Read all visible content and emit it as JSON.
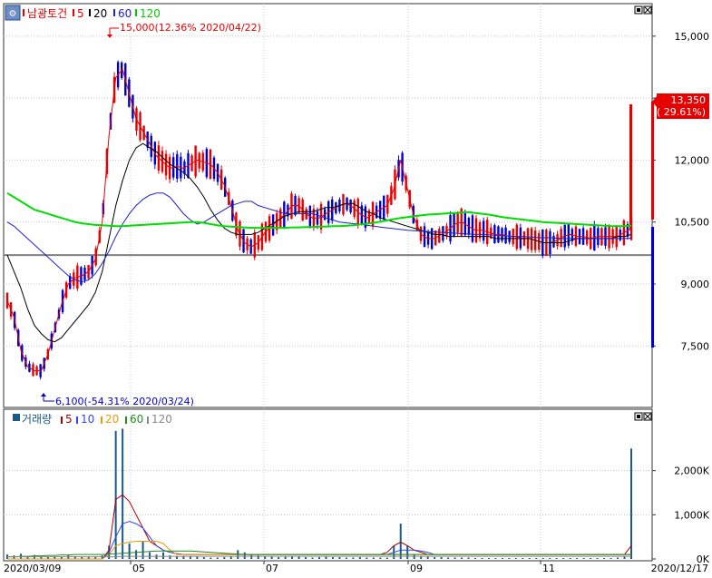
{
  "legend": {
    "price": {
      "name": "남광토건",
      "ma5": "5",
      "ma20": "20",
      "ma60": "60",
      "ma120": "120"
    },
    "volume": {
      "name": "거래량",
      "ma5": "5",
      "ma10": "10",
      "ma20": "20",
      "ma60": "60",
      "ma120": "120"
    }
  },
  "colors": {
    "up": "#e60000",
    "down": "#0000cc",
    "ma5": "#e60000",
    "ma20": "#000000",
    "ma60": "#2222cc",
    "ma120": "#00dd00",
    "vol_ma5": "#aa0000",
    "vol_ma10": "#3344ee",
    "vol_ma20": "#ee9900",
    "vol_ma60": "#228822",
    "vol_ma120": "#888888",
    "volume_bar": "#1a5a8a",
    "refline": "#808080"
  },
  "annotations": {
    "high": "15,000(12.36% 2020/04/22)",
    "low": "6,100(-54.31% 2020/03/24)"
  },
  "price_tag": {
    "value": "13,350",
    "change": "( 29.61%)"
  },
  "chart_data": [
    {
      "type": "candlestick",
      "ylim": [
        6100,
        15700
      ],
      "yticks": [
        "15,000",
        "13,500",
        "12,000",
        "10,500",
        "9,000",
        "7,500"
      ],
      "ytick_values": [
        15000,
        13500,
        12000,
        10500,
        9000,
        7500
      ],
      "reference_line": 9700,
      "xtick_labels": [
        "05",
        "07",
        "09",
        "11"
      ],
      "x_start_label": "2020/03/09",
      "x_end_label": "2020/12/17",
      "series": [
        {
          "name": "5",
          "values": [
            8600,
            8200,
            7400,
            7000,
            6900,
            6900,
            7300,
            7900,
            8500,
            9000,
            9150,
            9200,
            9300,
            9600,
            10500,
            12600,
            14000,
            14200,
            13600,
            13000,
            12700,
            12400,
            12100,
            11950,
            11800,
            11850,
            11800,
            11900,
            12000,
            11950,
            11900,
            11700,
            11400,
            10900,
            10300,
            10000,
            9900,
            10000,
            10250,
            10400,
            10550,
            10700,
            10900,
            10900,
            10700,
            10600,
            10600,
            10700,
            10800,
            10900,
            10950,
            10850,
            10700,
            10600,
            10700,
            10800,
            10900,
            11300,
            12000,
            11300,
            10600,
            10200,
            10100,
            10100,
            10200,
            10300,
            10450,
            10500,
            10400,
            10300,
            10300,
            10250,
            10200,
            10200,
            10150,
            10150,
            10100,
            10100,
            10050,
            10000,
            10000,
            10050,
            10150,
            10200,
            10150,
            10150,
            10100,
            10150,
            10150,
            10150,
            10150,
            10250,
            10350
          ]
        },
        {
          "name": "20",
          "values": [
            9700,
            9300,
            8900,
            8400,
            8000,
            7800,
            7650,
            7600,
            7700,
            7900,
            8100,
            8300,
            8500,
            8800,
            9300,
            10100,
            10900,
            11500,
            12000,
            12300,
            12400,
            12300,
            12200,
            12050,
            11900,
            11800,
            11700,
            11550,
            11350,
            11100,
            10800,
            10550,
            10350,
            10250,
            10200,
            10200,
            10200,
            10250,
            10350,
            10450,
            10550,
            10650,
            10700,
            10750,
            10750,
            10750,
            10800,
            10850,
            10850,
            10900,
            10950,
            10950,
            10850,
            10750,
            10700,
            10600,
            10550,
            10500,
            10450,
            10400,
            10350,
            10300,
            10250,
            10200,
            10200,
            10150,
            10150,
            10150,
            10150,
            10150,
            10150,
            10150,
            10100,
            10100,
            10100,
            10100,
            10100,
            10100,
            10050,
            10000,
            10000,
            10000,
            10000,
            10050,
            10100,
            10100,
            10100,
            10100,
            10100,
            10100,
            10150,
            10150,
            10200
          ]
        },
        {
          "name": "60",
          "values": [
            10500,
            10400,
            10250,
            10100,
            9950,
            9800,
            9650,
            9500,
            9350,
            9200,
            9100,
            9050,
            9100,
            9250,
            9500,
            9800,
            10150,
            10450,
            10700,
            10900,
            11050,
            11150,
            11200,
            11200,
            11100,
            10900,
            10700,
            10550,
            10450,
            10500,
            10600,
            10700,
            10800,
            10900,
            10950,
            11000,
            11000,
            10900,
            10850,
            10800,
            10750,
            10700,
            10700,
            10700,
            10700,
            10700,
            10650,
            10600,
            10550,
            10500,
            10480,
            10460,
            10450,
            10420,
            10400,
            10380,
            10360,
            10340,
            10320,
            10300,
            10290,
            10280,
            10270,
            10260,
            10250,
            10240,
            10230,
            10220,
            10210,
            10200,
            10200,
            10190,
            10180,
            10170,
            10160,
            10150,
            10150,
            10140,
            10130,
            10120,
            10120,
            10110,
            10100,
            10100,
            10100,
            10100,
            10100,
            10100,
            10100,
            10100,
            10100,
            10100,
            10110
          ]
        },
        {
          "name": "120",
          "values": [
            11200,
            11100,
            11000,
            10900,
            10800,
            10750,
            10700,
            10650,
            10600,
            10550,
            10500,
            10470,
            10450,
            10430,
            10420,
            10410,
            10400,
            10400,
            10410,
            10420,
            10430,
            10440,
            10450,
            10460,
            10470,
            10480,
            10490,
            10500,
            10500,
            10480,
            10450,
            10420,
            10400,
            10390,
            10380,
            10370,
            10360,
            10360,
            10360,
            10360,
            10360,
            10360,
            10370,
            10370,
            10380,
            10380,
            10390,
            10390,
            10400,
            10400,
            10410,
            10420,
            10440,
            10460,
            10480,
            10510,
            10540,
            10570,
            10600,
            10620,
            10640,
            10660,
            10680,
            10690,
            10700,
            10710,
            10720,
            10730,
            10740,
            10720,
            10700,
            10680,
            10650,
            10620,
            10600,
            10580,
            10560,
            10540,
            10520,
            10500,
            10490,
            10480,
            10470,
            10460,
            10450,
            10440,
            10430,
            10420,
            10410,
            10400,
            10400,
            10400,
            10410
          ]
        }
      ]
    },
    {
      "type": "bar",
      "ylim": [
        0,
        3000000
      ],
      "yticks": [
        "2,000K",
        "1,000K",
        "0K"
      ],
      "ytick_values": [
        2000000,
        1000000,
        0
      ],
      "series": [
        {
          "name": "5",
          "values": [
            0,
            0,
            0,
            0,
            0,
            0,
            0,
            0,
            0,
            0,
            0,
            0,
            0,
            0,
            0,
            200000,
            1350000,
            1450000,
            1300000,
            1000000,
            700000,
            400000,
            300000,
            200000,
            150000,
            120000,
            100000,
            100000,
            100000,
            100000,
            100000,
            100000,
            100000,
            100000,
            100000,
            100000,
            100000,
            100000,
            100000,
            100000,
            100000,
            100000,
            100000,
            100000,
            100000,
            100000,
            100000,
            100000,
            100000,
            100000,
            100000,
            100000,
            100000,
            100000,
            100000,
            100000,
            150000,
            300000,
            380000,
            300000,
            200000,
            150000,
            100000,
            100000,
            100000,
            100000,
            100000,
            100000,
            100000,
            100000,
            100000,
            100000,
            100000,
            100000,
            100000,
            100000,
            100000,
            100000,
            100000,
            100000,
            100000,
            100000,
            100000,
            100000,
            100000,
            100000,
            100000,
            100000,
            100000,
            100000,
            100000,
            100000,
            300000
          ]
        },
        {
          "name": "10",
          "values": [
            0,
            0,
            0,
            0,
            0,
            0,
            0,
            0,
            0,
            0,
            0,
            0,
            0,
            0,
            0,
            150000,
            500000,
            800000,
            850000,
            800000,
            700000,
            500000,
            300000,
            200000,
            150000,
            120000,
            100000,
            100000,
            100000,
            100000,
            100000,
            100000,
            100000,
            100000,
            100000,
            100000,
            100000,
            100000,
            100000,
            100000,
            100000,
            100000,
            100000,
            100000,
            100000,
            100000,
            100000,
            100000,
            100000,
            100000,
            100000,
            100000,
            100000,
            100000,
            100000,
            100000,
            100000,
            150000,
            200000,
            200000,
            200000,
            180000,
            150000,
            100000,
            100000,
            100000,
            100000,
            100000,
            100000,
            100000,
            100000,
            100000,
            100000,
            100000,
            100000,
            100000,
            100000,
            100000,
            100000,
            100000,
            100000,
            100000,
            100000,
            100000,
            100000,
            100000,
            100000,
            100000,
            100000,
            100000,
            100000,
            100000,
            100000
          ]
        },
        {
          "name": "20",
          "values": [
            0,
            0,
            0,
            0,
            0,
            0,
            0,
            0,
            0,
            0,
            0,
            0,
            0,
            0,
            0,
            100000,
            300000,
            350000,
            380000,
            400000,
            400000,
            400000,
            400000,
            350000,
            200000,
            100000,
            100000,
            100000,
            100000,
            100000,
            100000,
            100000,
            100000,
            100000,
            100000,
            100000,
            100000,
            100000,
            100000,
            100000,
            100000,
            100000,
            100000,
            100000,
            100000,
            100000,
            100000,
            100000,
            100000,
            100000,
            100000,
            100000,
            100000,
            100000,
            100000,
            100000,
            100000,
            100000,
            100000,
            100000,
            100000,
            100000,
            100000,
            100000,
            100000,
            100000,
            100000,
            100000,
            100000,
            100000,
            100000,
            100000,
            100000,
            100000,
            100000,
            100000,
            100000,
            100000,
            100000,
            100000,
            100000,
            100000,
            100000,
            100000,
            100000,
            100000,
            100000,
            100000,
            100000,
            100000,
            100000,
            100000,
            100000
          ]
        },
        {
          "name": "60",
          "values": [
            50000,
            50000,
            60000,
            60000,
            70000,
            70000,
            80000,
            80000,
            90000,
            90000,
            100000,
            100000,
            100000,
            100000,
            100000,
            110000,
            120000,
            130000,
            140000,
            150000,
            160000,
            170000,
            180000,
            180000,
            180000,
            180000,
            180000,
            180000,
            170000,
            160000,
            150000,
            140000,
            130000,
            120000,
            110000,
            100000,
            100000,
            100000,
            100000,
            100000,
            100000,
            100000,
            100000,
            100000,
            100000,
            100000,
            100000,
            100000,
            100000,
            100000,
            100000,
            100000,
            100000,
            100000,
            100000,
            100000,
            100000,
            100000,
            100000,
            100000,
            100000,
            100000,
            100000,
            100000,
            100000,
            100000,
            100000,
            100000,
            100000,
            100000,
            100000,
            100000,
            100000,
            100000,
            100000,
            100000,
            100000,
            100000,
            100000,
            100000,
            100000,
            100000,
            100000,
            100000,
            100000,
            100000,
            100000,
            100000,
            100000,
            100000,
            100000,
            100000,
            100000
          ]
        },
        {
          "name": "120",
          "values": [
            50000,
            50000,
            50000,
            50000,
            50000,
            50000,
            50000,
            50000,
            50000,
            50000,
            50000,
            50000,
            50000,
            50000,
            50000,
            50000,
            50000,
            60000,
            60000,
            60000,
            60000,
            60000,
            60000,
            60000,
            60000,
            60000,
            60000,
            60000,
            60000,
            60000,
            60000,
            60000,
            60000,
            60000,
            60000,
            60000,
            60000,
            60000,
            60000,
            60000,
            60000,
            60000,
            60000,
            60000,
            60000,
            60000,
            60000,
            60000,
            60000,
            60000,
            60000,
            60000,
            60000,
            60000,
            60000,
            60000,
            60000,
            60000,
            60000,
            60000,
            60000,
            60000,
            60000,
            60000,
            60000,
            60000,
            60000,
            60000,
            60000,
            60000,
            60000,
            60000,
            60000,
            60000,
            60000,
            60000,
            60000,
            60000,
            60000,
            60000,
            60000,
            60000,
            60000,
            60000,
            60000,
            60000,
            60000,
            60000,
            60000,
            60000,
            60000,
            60000,
            60000
          ]
        }
      ],
      "bars": [
        100000,
        80000,
        120000,
        60000,
        90000,
        70000,
        50000,
        60000,
        50000,
        80000,
        60000,
        50000,
        40000,
        50000,
        80000,
        300000,
        2900000,
        2950000,
        350000,
        200000,
        400000,
        150000,
        100000,
        150000,
        80000,
        60000,
        70000,
        60000,
        50000,
        40000,
        30000,
        30000,
        40000,
        50000,
        200000,
        150000,
        100000,
        80000,
        60000,
        50000,
        40000,
        50000,
        60000,
        50000,
        40000,
        30000,
        40000,
        50000,
        40000,
        40000,
        30000,
        30000,
        40000,
        30000,
        30000,
        30000,
        30000,
        300000,
        800000,
        300000,
        100000,
        60000,
        50000,
        40000,
        40000,
        30000,
        30000,
        30000,
        30000,
        20000,
        20000,
        20000,
        20000,
        20000,
        20000,
        20000,
        20000,
        20000,
        20000,
        20000,
        20000,
        20000,
        20000,
        20000,
        20000,
        20000,
        20000,
        20000,
        20000,
        20000,
        30000,
        50000,
        2500000
      ]
    }
  ]
}
